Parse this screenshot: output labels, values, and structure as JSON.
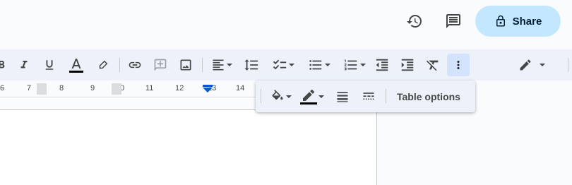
{
  "header": {
    "history_icon": "history-icon",
    "comments_icon": "comment-icon",
    "share": {
      "label": "Share",
      "icon": "lock-icon",
      "bg": "#c2e7ff"
    }
  },
  "toolbar": {
    "buttons": [
      {
        "name": "bold",
        "icon": "bold-icon"
      },
      {
        "name": "italic",
        "icon": "italic-icon"
      },
      {
        "name": "underline",
        "icon": "underline-icon"
      },
      {
        "name": "text-color",
        "icon": "text-color-icon"
      },
      {
        "name": "highlight",
        "icon": "highlighter-icon"
      },
      {
        "name": "insert-link",
        "icon": "link-icon"
      },
      {
        "name": "add-comment",
        "icon": "add-comment-icon"
      },
      {
        "name": "insert-image",
        "icon": "image-icon"
      },
      {
        "name": "align",
        "icon": "align-left-icon"
      },
      {
        "name": "line-spacing",
        "icon": "line-spacing-icon"
      },
      {
        "name": "checklist",
        "icon": "checklist-icon"
      },
      {
        "name": "bulleted-list",
        "icon": "bulleted-list-icon"
      },
      {
        "name": "numbered-list",
        "icon": "numbered-list-icon"
      },
      {
        "name": "decrease-indent",
        "icon": "decrease-indent-icon"
      },
      {
        "name": "increase-indent",
        "icon": "increase-indent-icon"
      },
      {
        "name": "clear-formatting",
        "icon": "clear-formatting-icon"
      },
      {
        "name": "more",
        "icon": "more-vert-icon"
      },
      {
        "name": "editing-mode",
        "icon": "pencil-icon"
      }
    ]
  },
  "ruler": {
    "labels": [
      "6",
      "7",
      "8",
      "9",
      "10",
      "11",
      "12",
      "13",
      "14"
    ]
  },
  "table_toolbar": {
    "table_options_label": "Table options",
    "buttons": [
      {
        "name": "cell-background",
        "icon": "paint-bucket-icon"
      },
      {
        "name": "border-color",
        "icon": "border-color-icon"
      },
      {
        "name": "border-width",
        "icon": "border-width-icon"
      },
      {
        "name": "border-dash",
        "icon": "border-dash-icon"
      }
    ]
  },
  "colors": {
    "accent": "#0b57d0",
    "toolbar_bg": "#edf2fa",
    "share_bg": "#c2e7ff"
  }
}
